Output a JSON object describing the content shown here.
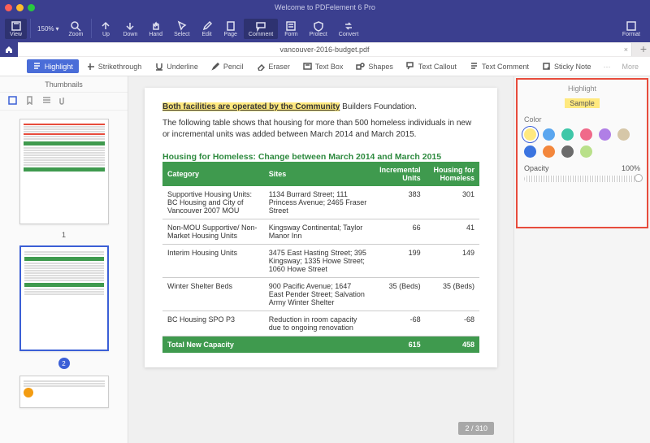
{
  "app": {
    "title": "Welcome to PDFelement 6 Pro"
  },
  "toolbar": {
    "view": "View",
    "zoom": "Zoom",
    "zoom_value": "150% ",
    "up": "Up",
    "down": "Down",
    "hand": "Hand",
    "select": "Select",
    "edit": "Edit",
    "page": "Page",
    "comment": "Comment",
    "form": "Form",
    "protect": "Protect",
    "convert": "Convert",
    "format": "Format"
  },
  "tabs": {
    "filename": "vancouver-2016-budget.pdf"
  },
  "subtoolbar": {
    "highlight": "Highlight",
    "strikethrough": "Strikethrough",
    "underline": "Underline",
    "pencil": "Pencil",
    "eraser": "Eraser",
    "textbox": "Text Box",
    "shapes": "Shapes",
    "textcallout": "Text Callout",
    "textcomment": "Text Comment",
    "stickynote": "Sticky Note",
    "more": "More"
  },
  "thumbnails": {
    "header": "Thumbnails",
    "page1_num": "1",
    "page2_num": "2"
  },
  "doc": {
    "hl_text": "Both facilities are operated by the Community",
    "hl_rest": " Builders Foundation.",
    "para": "The following table shows that housing for more than 500 homeless individuals in new or incremental units was added between March 2014 and March 2015.",
    "table_title": "Housing for Homeless: Change between March 2014 and March 2015",
    "headers": {
      "category": "Category",
      "sites": "Sites",
      "inc": "Incremental Units",
      "hfh": "Housing for Homeless"
    },
    "rows": [
      {
        "cat": "Supportive Housing Units: BC Housing and City of Vancouver 2007 MOU",
        "sites": "1134 Burrard Street; 111 Princess Avenue; 2465 Fraser Street",
        "inc": "383",
        "hfh": "301"
      },
      {
        "cat": "Non-MOU Supportive/ Non-Market Housing Units",
        "sites": "Kingsway Continental; Taylor Manor Inn",
        "inc": "66",
        "hfh": "41"
      },
      {
        "cat": "Interim Housing Units",
        "sites": "3475 East Hasting Street; 395 Kingsway; 1335 Howe Street; 1060 Howe Street",
        "inc": "199",
        "hfh": "149"
      },
      {
        "cat": "Winter Shelter Beds",
        "sites": "900 Pacific Avenue; 1647 East Pender Street; Salvation Army Winter Shelter",
        "inc": "35 (Beds)",
        "hfh": "35 (Beds)"
      },
      {
        "cat": "BC Housing SPO P3",
        "sites": "Reduction in room capacity due to ongoing renovation",
        "inc": "-68",
        "hfh": "-68"
      }
    ],
    "total": {
      "label": "Total New Capacity",
      "inc": "615",
      "hfh": "458"
    },
    "page_indicator": "2 / 310"
  },
  "props": {
    "title": "Highlight",
    "sample": "Sample",
    "color_label": "Color",
    "opacity_label": "Opacity",
    "opacity_value": "100%",
    "colors_row1": [
      "#ffe97f",
      "#5aa6ef",
      "#3fc7a8",
      "#f06a8a",
      "#b07fe6",
      "#d6c7a8"
    ],
    "colors_row2": [
      "#3b74e0",
      "#f3873c",
      "#6b6b6b",
      "#b9e08a"
    ]
  }
}
